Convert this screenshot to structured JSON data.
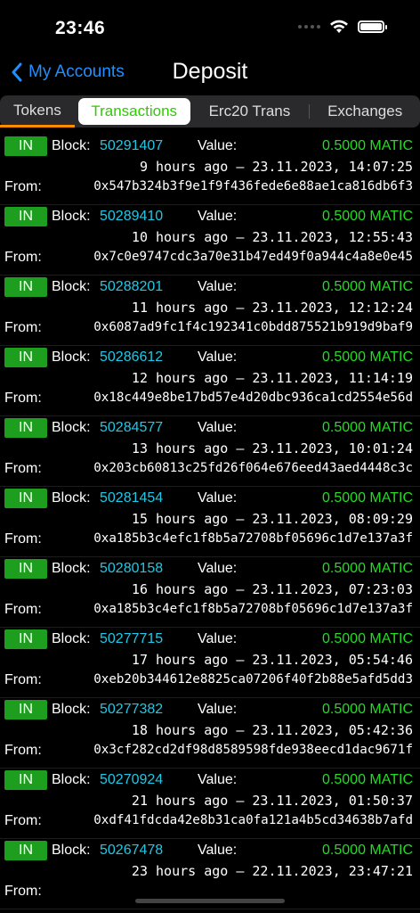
{
  "status_bar": {
    "time": "23:46"
  },
  "nav": {
    "back_label": "My Accounts",
    "title": "Deposit"
  },
  "tabs": [
    {
      "label": "Tokens"
    },
    {
      "label": "Transactions"
    },
    {
      "label": "Erc20 Trans"
    },
    {
      "label": "Exchanges"
    }
  ],
  "labels": {
    "block": "Block:",
    "value": "Value:",
    "from": "From:"
  },
  "colors": {
    "accent_blue": "#1e90ff",
    "amount_green": "#22dd22",
    "badge_green": "#1e9e1e",
    "block_cyan": "#1ec8e6",
    "tab_underline": "#ff8c00"
  },
  "transactions": [
    {
      "direction": "IN",
      "block": "50291407",
      "amount": "0.5000 MATIC",
      "time": "9 hours ago – 23.11.2023, 14:07:25",
      "from": "0x547b324b3f9e1f9f436fede6e88ae1ca816db6f3"
    },
    {
      "direction": "IN",
      "block": "50289410",
      "amount": "0.5000 MATIC",
      "time": "10 hours ago – 23.11.2023, 12:55:43",
      "from": "0x7c0e9747cdc3a70e31b47ed49f0a944c4a8e0e45"
    },
    {
      "direction": "IN",
      "block": "50288201",
      "amount": "0.5000 MATIC",
      "time": "11 hours ago – 23.11.2023, 12:12:24",
      "from": "0x6087ad9fc1f4c192341c0bdd875521b919d9baf9"
    },
    {
      "direction": "IN",
      "block": "50286612",
      "amount": "0.5000 MATIC",
      "time": "12 hours ago – 23.11.2023, 11:14:19",
      "from": "0x18c449e8be17bd57e4d20dbc936ca1cd2554e56d"
    },
    {
      "direction": "IN",
      "block": "50284577",
      "amount": "0.5000 MATIC",
      "time": "13 hours ago – 23.11.2023, 10:01:24",
      "from": "0x203cb60813c25fd26f064e676eed43aed4448c3c"
    },
    {
      "direction": "IN",
      "block": "50281454",
      "amount": "0.5000 MATIC",
      "time": "15 hours ago – 23.11.2023, 08:09:29",
      "from": "0xa185b3c4efc1f8b5a72708bf05696c1d7e137a3f"
    },
    {
      "direction": "IN",
      "block": "50280158",
      "amount": "0.5000 MATIC",
      "time": "16 hours ago – 23.11.2023, 07:23:03",
      "from": "0xa185b3c4efc1f8b5a72708bf05696c1d7e137a3f"
    },
    {
      "direction": "IN",
      "block": "50277715",
      "amount": "0.5000 MATIC",
      "time": "17 hours ago – 23.11.2023, 05:54:46",
      "from": "0xeb20b344612e8825ca07206f40f2b88e5afd5dd3"
    },
    {
      "direction": "IN",
      "block": "50277382",
      "amount": "0.5000 MATIC",
      "time": "18 hours ago – 23.11.2023, 05:42:36",
      "from": "0x3cf282cd2df98d8589598fde938eecd1dac9671f"
    },
    {
      "direction": "IN",
      "block": "50270924",
      "amount": "0.5000 MATIC",
      "time": "21 hours ago – 23.11.2023, 01:50:37",
      "from": "0xdf41fdcda42e8b31ca0fa121a4b5cd34638b7afd"
    },
    {
      "direction": "IN",
      "block": "50267478",
      "amount": "0.5000 MATIC",
      "time": "23 hours ago – 22.11.2023, 23:47:21",
      "from": ""
    }
  ]
}
